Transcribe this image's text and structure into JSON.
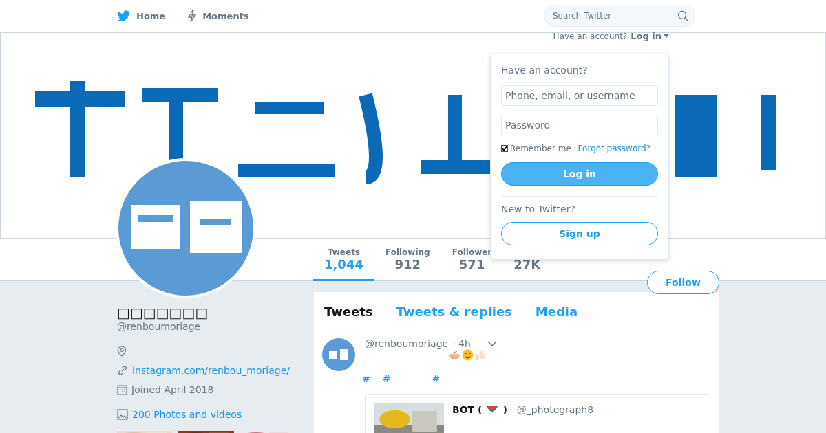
{
  "nav": {
    "items": [
      {
        "kind": "bird",
        "label": "Home"
      },
      {
        "kind": "bolt",
        "label": "Moments"
      }
    ],
    "search": {
      "placeholder": "Search Twitter"
    }
  },
  "account_prompt": {
    "text": "Have an account?",
    "login": "Log in"
  },
  "login_popup": {
    "title": "Have an account?",
    "username": {
      "placeholder": "Phone, email, or username"
    },
    "password": {
      "placeholder": "Password"
    },
    "remember": {
      "label": "Remember me",
      "checked": true
    },
    "separator": "·",
    "forgot": "Forgot password?",
    "login_button": "Log in",
    "new_prompt": "New to Twitter?",
    "signup_button": "Sign up"
  },
  "profile": {
    "name": "□□□□□□□",
    "handle": "@renboumoriage",
    "website": "instagram.com/renbou_moriage/",
    "joined": "Joined April 2018",
    "photos_link": "200 Photos and videos"
  },
  "stats": [
    {
      "label": "Tweets",
      "value": "1,044",
      "selected": true
    },
    {
      "label": "Following",
      "value": "912",
      "selected": false
    },
    {
      "label": "Follower",
      "value": "571",
      "selected": false
    },
    {
      "value": "27K",
      "selected": false
    }
  ],
  "follow_button": "Follow",
  "timeline_tabs": [
    {
      "label": "Tweets",
      "selected": true
    },
    {
      "label": "Tweets & replies",
      "selected": false
    },
    {
      "label": "Media",
      "selected": false
    }
  ],
  "tweet": {
    "handle": "@renboumoriage",
    "time": "· 4h",
    "emojis": [
      {
        "kind": "bowl"
      },
      {
        "kind": "smile"
      },
      {
        "kind": "thumb"
      }
    ],
    "hashtags": [
      "#",
      "#",
      "#"
    ],
    "quote": {
      "name": "BOT (",
      "emoji": {
        "kind": "watermelon"
      },
      "name_end": ")",
      "handle": "@_photograph8"
    }
  }
}
